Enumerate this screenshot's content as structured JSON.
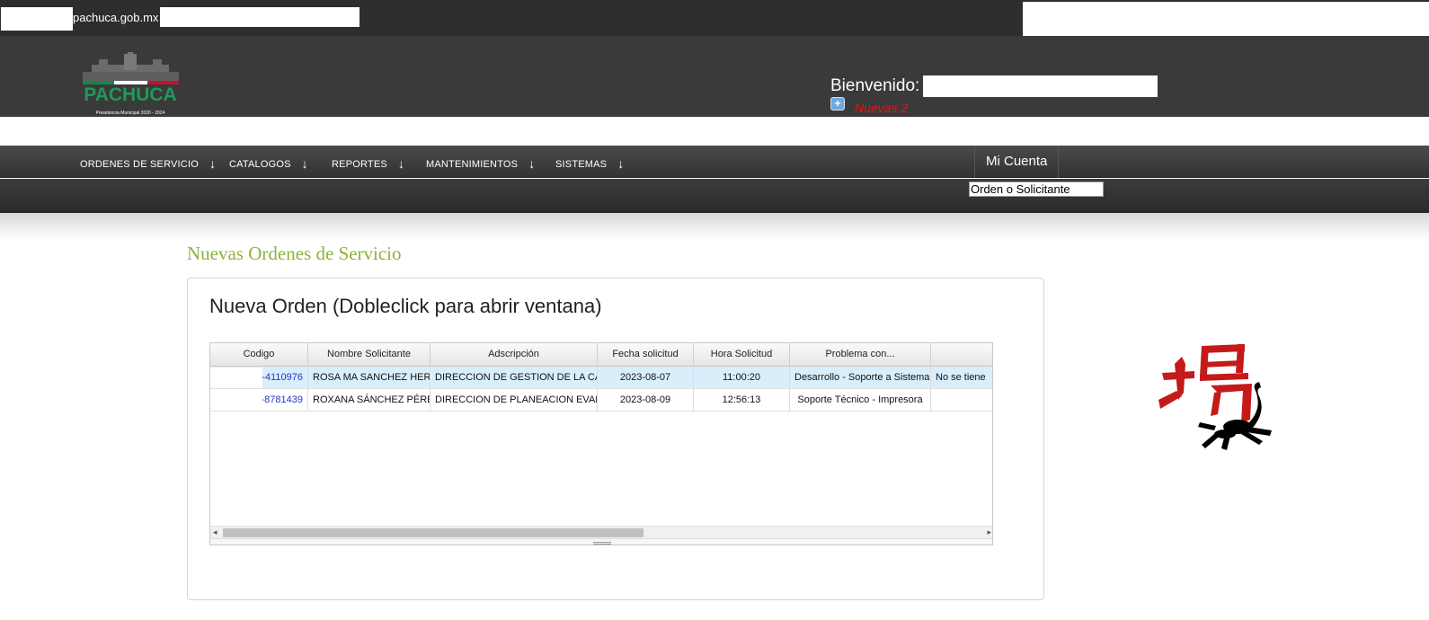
{
  "browser": {
    "domain": "pachuca.gob.mx"
  },
  "header": {
    "logo_text": "PACHUCA",
    "logo_subtext": "Presidencia Municipal 2020 - 2024",
    "welcome_label": "Bienvenido:",
    "nuevas_label": "Nuevas 2"
  },
  "nav": {
    "items": [
      "ORDENES DE SERVICIO",
      "CATALOGOS",
      "REPORTES",
      "MANTENIMIENTOS",
      "SISTEMAS"
    ],
    "arrow": "↓",
    "account_label": "Mi Cuenta",
    "search_value": "Orden o Solicitante"
  },
  "main": {
    "section_title": "Nuevas Ordenes de Servicio",
    "panel_title": "Nueva Orden (Dobleclick para abrir ventana)",
    "grid": {
      "columns": [
        "Codigo",
        "Nombre Solicitante",
        "Adscripción",
        "Fecha solicitud",
        "Hora Solicitud",
        "Problema con...",
        ""
      ],
      "rows": [
        [
          "-4110976",
          "ROSA MA SANCHEZ HERNANDEZ",
          "DIRECCION DE GESTION DE LA CALIDAD",
          "2023-08-07",
          "11:00:20",
          "Desarrollo - Soporte a Sistema",
          "No se tiene"
        ],
        [
          "-8781439",
          "ROXANA SÁNCHEZ PÉREZ",
          "DIRECCION DE PLANEACION EVALUACION",
          "2023-08-09",
          "12:56:13",
          "Soporte Técnico - Impresora",
          ""
        ]
      ]
    }
  },
  "colors": {
    "accent_green": "#8db33a",
    "alert_red": "#ee1111",
    "header_bg": "#3a3a3a",
    "link_blue": "#2233cc"
  },
  "icons": [
    "plus-square-icon",
    "down-arrow-icon",
    "scorpion-logo"
  ]
}
